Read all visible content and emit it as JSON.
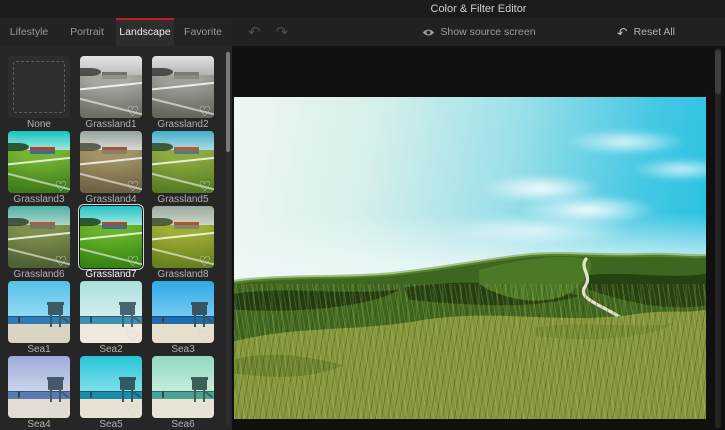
{
  "title_bar": {
    "title": "Color & Filter Editor"
  },
  "tabs": {
    "items": [
      "Lifestyle",
      "Portrait",
      "Landscape",
      "Favorite"
    ],
    "active": "Landscape",
    "accent_color": "#c41e1c"
  },
  "toolbar": {
    "show_source_label": "Show source screen",
    "reset_all_label": "Reset All"
  },
  "icons": {
    "undo": "↶",
    "redo": "↷",
    "reset": "↶",
    "heart": "♡"
  },
  "filters": {
    "selected": "Grassland7",
    "items": [
      {
        "name": "None",
        "kind": "none",
        "colors": {}
      },
      {
        "name": "Grassland1",
        "kind": "grass",
        "colors": {
          "sky": "#e6e6e4",
          "sky2": "#b8bebc",
          "grass": "#a8a8a2",
          "grass2": "#6e6e66",
          "roof": "#707070",
          "hut": "#90908a",
          "trees": "#3c3c3a"
        }
      },
      {
        "name": "Grassland2",
        "kind": "grass",
        "colors": {
          "sky": "#e2e2e0",
          "sky2": "#b0b6b4",
          "grass": "#a0a09a",
          "grass2": "#66665e",
          "roof": "#787878",
          "hut": "#8a8a84",
          "trees": "#383836"
        }
      },
      {
        "name": "Grassland3",
        "kind": "grass",
        "colors": {
          "sky": "#14c4c2",
          "sky2": "#9fe6da",
          "grass": "#76b432",
          "grass2": "#3e7c1a",
          "roof": "#b5402e",
          "hut": "#3f6f86",
          "trees": "#1f3d1c"
        }
      },
      {
        "name": "Grassland4",
        "kind": "grass",
        "colors": {
          "sky": "#96a29c",
          "sky2": "#d6dcd4",
          "grass": "#a29468",
          "grass2": "#6e6244",
          "roof": "#a2563e",
          "hut": "#8a7e6a",
          "trees": "#4a4a3c"
        }
      },
      {
        "name": "Grassland5",
        "kind": "grass",
        "colors": {
          "sky": "#42aeca",
          "sky2": "#aadce2",
          "grass": "#8cab40",
          "grass2": "#577c24",
          "roof": "#bc5c2c",
          "hut": "#5a7a7a",
          "trees": "#2c4420"
        }
      },
      {
        "name": "Grassland6",
        "kind": "grass",
        "colors": {
          "sky": "#4cb2a6",
          "sky2": "#aed6c8",
          "grass": "#81904e",
          "grass2": "#4f6034",
          "roof": "#aa5c40",
          "hut": "#6a7a62",
          "trees": "#30422a"
        }
      },
      {
        "name": "Grassland7",
        "kind": "grass",
        "colors": {
          "sky": "#22c2c8",
          "sky2": "#a2e8de",
          "grass": "#6ab42a",
          "grass2": "#368414",
          "roof": "#b84426",
          "hut": "#3f7080",
          "trees": "#1e3e18"
        }
      },
      {
        "name": "Grassland8",
        "kind": "grass",
        "colors": {
          "sky": "#9cab9e",
          "sky2": "#ccd6c4",
          "grass": "#9fae34",
          "grass2": "#68801e",
          "roof": "#b05430",
          "hut": "#7a8a6a",
          "trees": "#3e4a2c"
        }
      },
      {
        "name": "Sea1",
        "kind": "sea",
        "colors": {
          "sky": "#57c0e8",
          "sky2": "#93daf2",
          "sea": "#2e7cb2",
          "sand": "#dad4c4",
          "tower": "#3c5a64"
        }
      },
      {
        "name": "Sea2",
        "kind": "sea",
        "colors": {
          "sky": "#abdfde",
          "sky2": "#d2efec",
          "sea": "#3e90b0",
          "sand": "#efe9dc",
          "tower": "#456670"
        }
      },
      {
        "name": "Sea3",
        "kind": "sea",
        "colors": {
          "sky": "#2fa9e6",
          "sky2": "#74cbf2",
          "sea": "#1f6dab",
          "sand": "#e6dfcb",
          "tower": "#37555e"
        }
      },
      {
        "name": "Sea4",
        "kind": "sea",
        "colors": {
          "sky": "#9dabda",
          "sky2": "#cbd3ea",
          "sea": "#5a7ab0",
          "sand": "#e2dcd2",
          "tower": "#46586a"
        }
      },
      {
        "name": "Sea5",
        "kind": "sea",
        "colors": {
          "sky": "#28c3da",
          "sky2": "#7fdfe9",
          "sea": "#1a8cab",
          "sand": "#e8e2d3",
          "tower": "#2f5a62"
        }
      },
      {
        "name": "Sea6",
        "kind": "sea",
        "colors": {
          "sky": "#90d9c4",
          "sky2": "#c5edd9",
          "sea": "#4aa392",
          "sand": "#e8e4d5",
          "tower": "#3a6058"
        }
      }
    ]
  },
  "preview": {
    "scene": {
      "sky_left": "#eff7f2",
      "sky_right": "#1fbfe2",
      "dune_green": "#3e6620",
      "dune_ridge_light": "#6d9a31",
      "dune_shadow": "#1c3410",
      "mid_dune": "#4d7a27",
      "foreground_grass": "#83963c",
      "trail_color": "#ebe9d8"
    }
  }
}
